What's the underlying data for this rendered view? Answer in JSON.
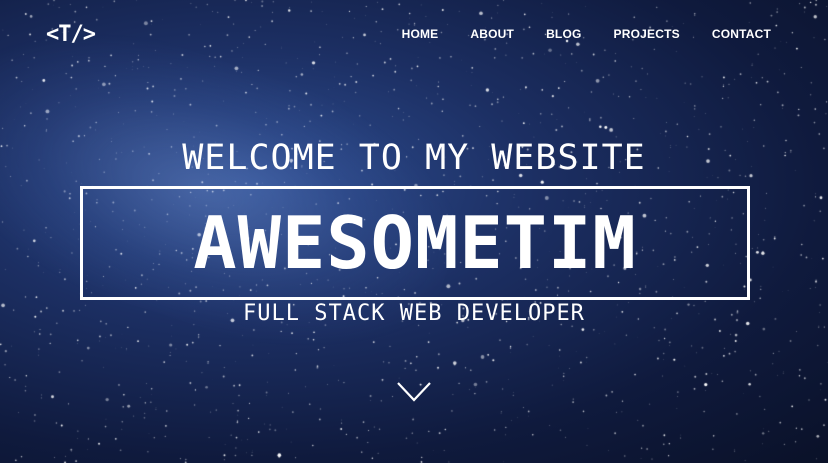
{
  "logo": {
    "text": "<T/>"
  },
  "nav": {
    "items": [
      "HOME",
      "ABOUT",
      "BLOG",
      "PROJECTS",
      "CONTACT"
    ]
  },
  "hero": {
    "welcome": "WELCOME TO MY WEBSITE",
    "name": "AWESOMETIM",
    "subtitle": "FULL STACK WEB DEVELOPER"
  },
  "icons": {
    "scroll": "chevron-down-icon"
  },
  "colors": {
    "background": "#1c2f63",
    "text": "#ffffff"
  }
}
